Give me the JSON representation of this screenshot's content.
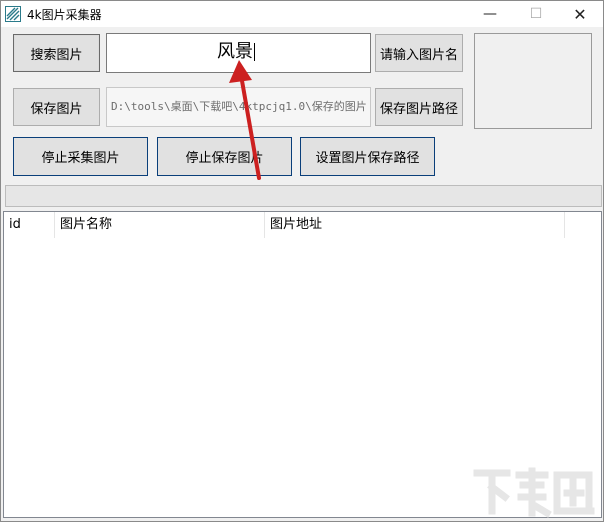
{
  "window": {
    "title": "4k图片采集器",
    "minimize_glyph": "—",
    "maximize_glyph": "☐",
    "close_glyph": "✕"
  },
  "toolbar": {
    "search_button": "搜索图片",
    "search_value": "风景",
    "search_hint_button": "请输入图片名",
    "save_button": "保存图片",
    "save_path": "D:\\tools\\桌面\\下载吧\\4ktpcjq1.0\\保存的图片",
    "save_path_button": "保存图片路径",
    "stop_collect_button": "停止采集图片",
    "stop_save_button": "停止保存图片",
    "set_path_button": "设置图片保存路径"
  },
  "progress": {
    "value": 0
  },
  "table": {
    "columns": [
      "id",
      "图片名称",
      "图片地址"
    ],
    "rows": []
  },
  "colors": {
    "annotation_arrow": "#cc2020",
    "window_bg": "#f0f0f0"
  },
  "icons": {
    "app": "app-stripes-icon",
    "watermark": "xiazaiba-watermark-icon"
  }
}
